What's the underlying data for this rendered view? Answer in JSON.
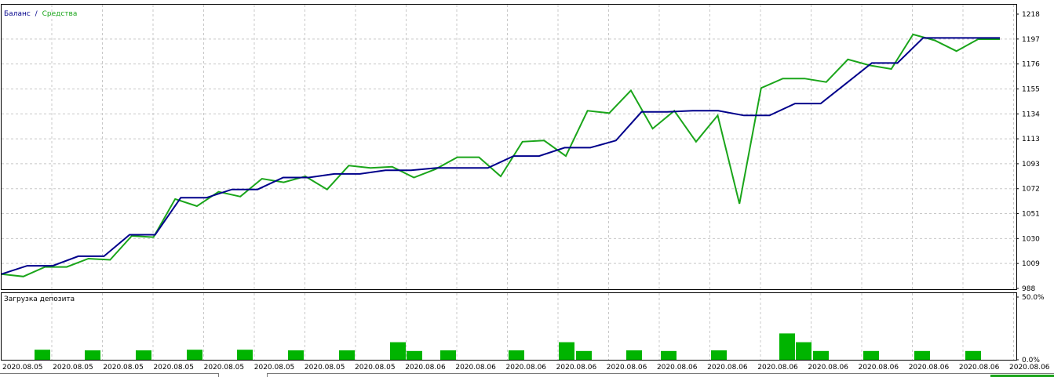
{
  "legend": {
    "balance_label": "Баланс",
    "separator": "/",
    "equity_label": "Средства",
    "balance_color": "#00008b",
    "equity_color": "#1aa51a"
  },
  "chart_data": [
    {
      "type": "line",
      "title": "",
      "ylim": [
        988,
        1218
      ],
      "yticks": [
        "1218",
        "1197",
        "1176",
        "1155",
        "1134",
        "1113",
        "1093",
        "1072",
        "1051",
        "1030",
        "1009",
        "988"
      ],
      "grid": true,
      "legend_position": "top-left",
      "series": [
        {
          "name": "Баланс",
          "color": "#00008b",
          "values": [
            1000,
            1007,
            1007,
            1015,
            1015,
            1033,
            1033,
            1064,
            1064,
            1071,
            1071,
            1081,
            1081,
            1084,
            1084,
            1087,
            1087,
            1089,
            1089,
            1089,
            1099,
            1099,
            1106,
            1106,
            1112,
            1136,
            1136,
            1137,
            1137,
            1133,
            1133,
            1143,
            1143,
            1160,
            1177,
            1177,
            1198,
            1198,
            1198,
            1198
          ]
        },
        {
          "name": "Средства",
          "color": "#1aa51a",
          "values": [
            1000,
            998,
            1006,
            1006,
            1013,
            1012,
            1032,
            1031,
            1063,
            1057,
            1069,
            1065,
            1080,
            1077,
            1082,
            1071,
            1091,
            1089,
            1090,
            1081,
            1088,
            1098,
            1098,
            1082,
            1111,
            1112,
            1099,
            1137,
            1135,
            1154,
            1122,
            1137,
            1111,
            1133,
            1059,
            1156,
            1164,
            1164,
            1161,
            1180,
            1175,
            1172,
            1201,
            1196,
            1187,
            1197,
            1197
          ]
        }
      ]
    },
    {
      "type": "bar",
      "title": "Загрузка депозита",
      "ylim": [
        0,
        50
      ],
      "yticks": [
        "50.0%",
        "0.0%"
      ],
      "color": "#00b400",
      "values": [
        8,
        7.5,
        7.5,
        8,
        8,
        7.5,
        7.5,
        14,
        7,
        7.5,
        7.5,
        14,
        7,
        7.5,
        7,
        7.5,
        21,
        14,
        7,
        7,
        7,
        7
      ],
      "xlabels": [
        "2020.08.05",
        "2020.08.05",
        "2020.08.05",
        "2020.08.05",
        "2020.08.05",
        "2020.08.05",
        "2020.08.05",
        "2020.08.05",
        "2020.08.06",
        "2020.08.06",
        "2020.08.06",
        "2020.08.06",
        "2020.08.06",
        "2020.08.06",
        "2020.08.06",
        "2020.08.06",
        "2020.08.06",
        "2020.08.06",
        "2020.08.06",
        "2020.08.06",
        "2020.08.06"
      ]
    }
  ]
}
